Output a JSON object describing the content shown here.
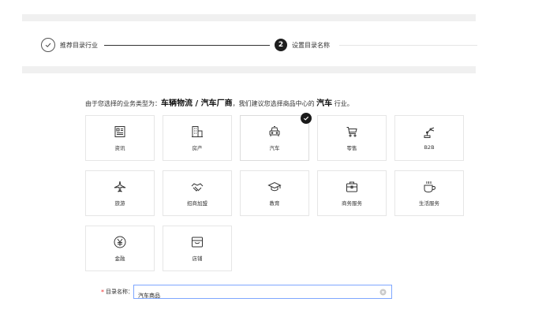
{
  "steps": [
    {
      "label": "推荐目录行业",
      "state": "done"
    },
    {
      "number": "2",
      "label": "设置目录名称",
      "state": "active"
    }
  ],
  "hint": {
    "prefix": "由于您选择的业务类型为：",
    "business_type": "车辆物流 / 汽车厂商",
    "middle": "，我们建议您选择商品中心的",
    "industry": "汽车",
    "suffix": "行业。"
  },
  "categories": [
    {
      "label": "资讯",
      "icon": "news-icon",
      "selected": false
    },
    {
      "label": "房产",
      "icon": "building-icon",
      "selected": false
    },
    {
      "label": "汽车",
      "icon": "car-icon",
      "selected": true
    },
    {
      "label": "零售",
      "icon": "cart-icon",
      "selected": false
    },
    {
      "label": "B2B",
      "icon": "robot-arm-icon",
      "selected": false
    },
    {
      "label": "旅游",
      "icon": "airplane-icon",
      "selected": false
    },
    {
      "label": "招商加盟",
      "icon": "handshake-icon",
      "selected": false
    },
    {
      "label": "教育",
      "icon": "graduation-cap-icon",
      "selected": false
    },
    {
      "label": "商务服务",
      "icon": "briefcase-icon",
      "selected": false
    },
    {
      "label": "生活服务",
      "icon": "coffee-cup-icon",
      "selected": false
    },
    {
      "label": "金融",
      "icon": "yuan-icon",
      "selected": false
    },
    {
      "label": "店铺",
      "icon": "store-icon",
      "selected": false
    }
  ],
  "form": {
    "required_mark": "*",
    "label": "目录名称：",
    "value": "汽车商品"
  },
  "colors": {
    "input_focus_border": "#7ea7ff",
    "active_step": "#1e1e1e",
    "required": "#ee3333"
  }
}
